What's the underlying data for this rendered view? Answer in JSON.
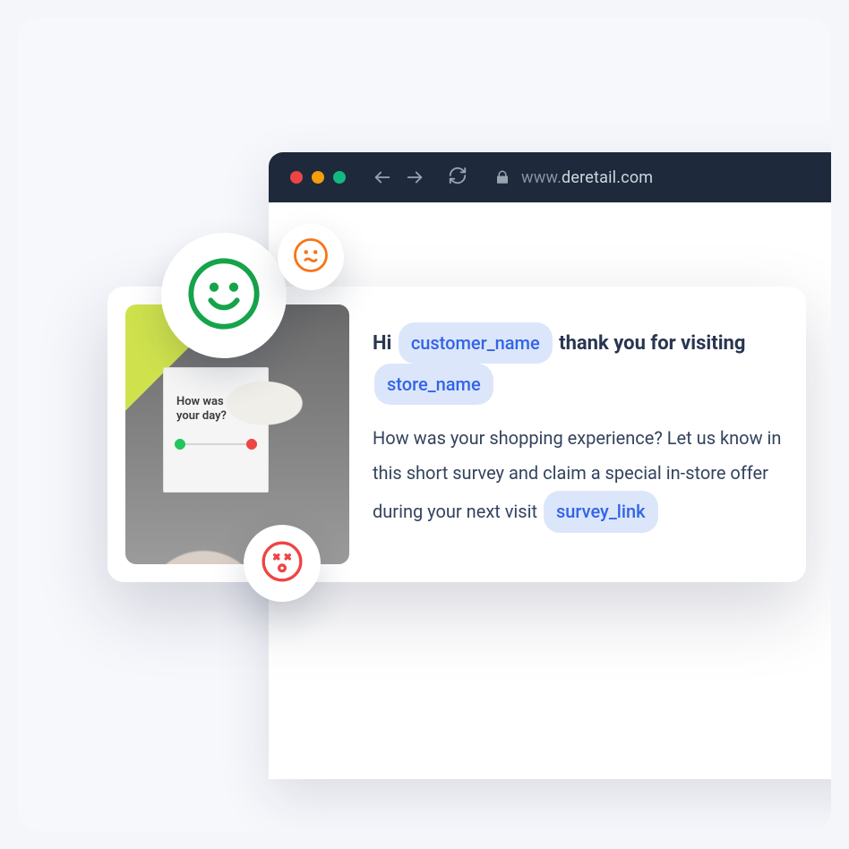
{
  "browser": {
    "url_prefix": "www.",
    "url_host": "deretail.com"
  },
  "card": {
    "greeting_pre": "Hi ",
    "token_customer": "customer_name",
    "greeting_mid": " thank you for visiting ",
    "token_store": "store_name",
    "body_text": "How was your shopping experience? Let us know in this short survey and claim a special in-store offer during your next visit ",
    "token_link": "survey_link",
    "poster_caption_line1": "How was",
    "poster_caption_line2": "your day?"
  }
}
